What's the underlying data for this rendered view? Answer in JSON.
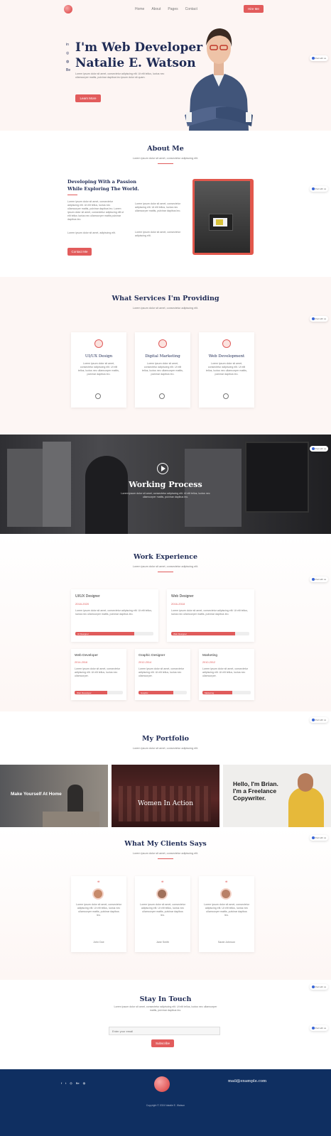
{
  "nav": {
    "items": [
      "Home",
      "About",
      "Pages",
      "Contact"
    ],
    "cta": "Hire Me"
  },
  "hero": {
    "line1": "I'm Web Developer",
    "line2": "Natalie E. Watson",
    "text": "Lorem ipsum dolor sit amet, consectetur adipiscing elit. Ut elit tellus, luctus nec ullamcorper mattis, pulvinar dapibus leo ipsum dolor sit quam.",
    "button": "Learn More",
    "social": [
      "in",
      "◎",
      "◍",
      "Be"
    ]
  },
  "about": {
    "title": "About Me",
    "subtitle": "Lorem ipsum dolor sit amet, consectetur adipiscing elit.",
    "heading1": "Developing With a Passion",
    "heading2": "While Exploring The World.",
    "para1": "Lorem ipsum dolor sit amet, consectetur adipiscing elit. Ut elit tellus, luctus nec ullamcorper mattis, pulvinar dapibus leo. Lorem ipsum dolor sit amet, consectetur adipiscing elit ut elit tellus luctus nec ullamcorper mattis pulvinar dapibus leo.",
    "para2": "Lorem ipsum dolor sit amet, adipiscing elit.",
    "para3": "Lorem ipsum dolor sit amet, consectetur adipiscing elit. Ut elit tellus, luctus nec ullamcorper mattis, pulvinar dapibus leo.",
    "para4": "Lorem ipsum dolor sit amet, consectetur adipiscing elit.",
    "button": "Contact Me"
  },
  "services": {
    "title": "What Services I'm Providing",
    "subtitle": "Lorem ipsum dolor sit amet, consectetur adipiscing elit.",
    "items": [
      {
        "name": "UI/UX Design",
        "text": "Lorem ipsum dolor sit amet, consectetur adipiscing elit. Ut elit tellus, luctus nec ullamcorper mattis, pulvinar dapibus leo."
      },
      {
        "name": "Digital Marketing",
        "text": "Lorem ipsum dolor sit amet, consectetur adipiscing elit. Ut elit tellus, luctus nec ullamcorper mattis, pulvinar dapibus leo."
      },
      {
        "name": "Web Development",
        "text": "Lorem ipsum dolor sit amet, consectetur adipiscing elit. Ut elit tellus, luctus nec ullamcorper mattis, pulvinar dapibus leo."
      }
    ]
  },
  "process": {
    "title": "Working Process",
    "text": "Lorem ipsum dolor sit amet, consectetur adipiscing elit. Ut elit tellus, luctus nec ullamcorper mattis, pulvinar dapibus leo."
  },
  "experience": {
    "title": "Work Experience",
    "subtitle": "Lorem ipsum dolor sit amet, consectetur adipiscing elit.",
    "big": [
      {
        "role": "UI/UX Designer",
        "years": "2018-2020",
        "text": "Lorem ipsum dolor sit amet, consectetur adipiscing elit. Ut elit tellus, luctus nec ullamcorper mattis, pulvinar dapibus leo.",
        "bar": "UI Designer",
        "level": 0.75
      },
      {
        "role": "Web Designer",
        "years": "2016-2018",
        "text": "Lorem ipsum dolor sit amet, consectetur adipiscing elit. Ut elit tellus, luctus nec ullamcorper mattis, pulvinar dapibus leo.",
        "bar": "Web Designer",
        "level": 0.82
      }
    ],
    "small": [
      {
        "role": "Web Developer",
        "years": "2014-2016",
        "text": "Lorem ipsum dolor sit amet, consectetur adipiscing elit. Ut elit tellus, luctus nec ullamcorper.",
        "bar": "Web Developer",
        "level": 0.68
      },
      {
        "role": "Graphic Designer",
        "years": "2012-2014",
        "text": "Lorem ipsum dolor sit amet, consectetur adipiscing elit. Ut elit tellus, luctus nec ullamcorper.",
        "bar": "Graphic",
        "level": 0.72
      },
      {
        "role": "Marketing",
        "years": "2010-2012",
        "text": "Lorem ipsum dolor sit amet, consectetur adipiscing elit. Ut elit tellus, luctus nec ullamcorper.",
        "bar": "Marketing",
        "level": 0.62
      }
    ]
  },
  "portfolio": {
    "title": "My Portfolio",
    "subtitle": "Lorem ipsum dolor sit amet, consectetur adipiscing elit.",
    "items": [
      {
        "caption": "Make Yourself At Home"
      },
      {
        "caption": "Women In Action"
      },
      {
        "caption": "Hello, I'm Brian. I'm a Freelance Copywriter."
      }
    ]
  },
  "testimonials": {
    "title": "What My Clients Says",
    "subtitle": "Lorem ipsum dolor sit amet, consectetur adipiscing elit.",
    "items": [
      {
        "text": "Lorem ipsum dolor sit amet, consectetur adipiscing elit. Ut elit tellus, luctus nec ullamcorper mattis, pulvinar dapibus leo.",
        "name": "John Doe"
      },
      {
        "text": "Lorem ipsum dolor sit amet, consectetur adipiscing elit. Ut elit tellus, luctus nec ullamcorper mattis, pulvinar dapibus leo.",
        "name": "Jane Smith"
      },
      {
        "text": "Lorem ipsum dolor sit amet, consectetur adipiscing elit. Ut elit tellus, luctus nec ullamcorper mattis, pulvinar dapibus leo.",
        "name": "Sarah Johnson"
      }
    ]
  },
  "contact": {
    "title": "Stay In Touch",
    "text": "Lorem ipsum dolor sit amet, consectetur adipiscing elit. Ut elit tellus, luctus nec ullamcorper mattis, pulvinar dapibus leo.",
    "placeholder": "Enter your email",
    "button": "Subscribe"
  },
  "footer": {
    "email": "mail@example.com",
    "copyright": "Copyright © 2024 Natalie E. Watson",
    "social": [
      "f",
      "t",
      "◎",
      "Be",
      "◍"
    ]
  },
  "chat_widget": {
    "label": "Chat with us"
  },
  "colors": {
    "accent": "#e05b5b",
    "navy": "#0f2f61",
    "heading": "#1f2b55",
    "hero_bg": "#fdf5f3"
  }
}
